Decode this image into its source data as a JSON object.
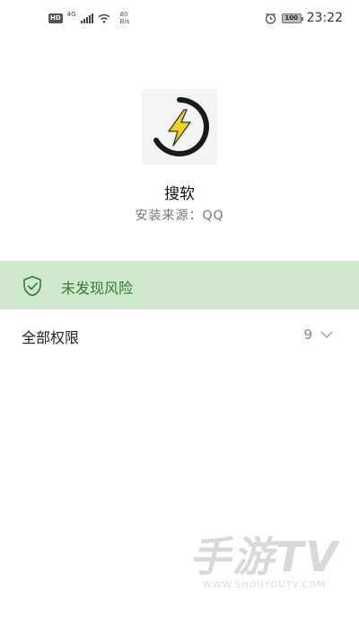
{
  "status_bar": {
    "hd_badge": "HD",
    "network_type": "4G",
    "speed_value": "80",
    "speed_unit": "B/s",
    "battery": "100",
    "time": "23:22",
    "icons": [
      "signal-icon",
      "wifi-icon",
      "alarm-icon",
      "battery-icon"
    ]
  },
  "app": {
    "icon": "lightning-bolt-icon",
    "name": "搜软",
    "source_label": "安装来源",
    "source_separator": "：",
    "source_value": "QQ"
  },
  "risk_banner": {
    "icon": "shield-check-icon",
    "text": "未发现风险",
    "background": "#cfe8cc",
    "text_color": "#2e7d32"
  },
  "permissions": {
    "label": "全部权限",
    "count": "9",
    "icon": "chevron-down-icon"
  },
  "watermark": {
    "main": "手游TV",
    "sub": "WWW.SHOUYOUTV.COM"
  }
}
